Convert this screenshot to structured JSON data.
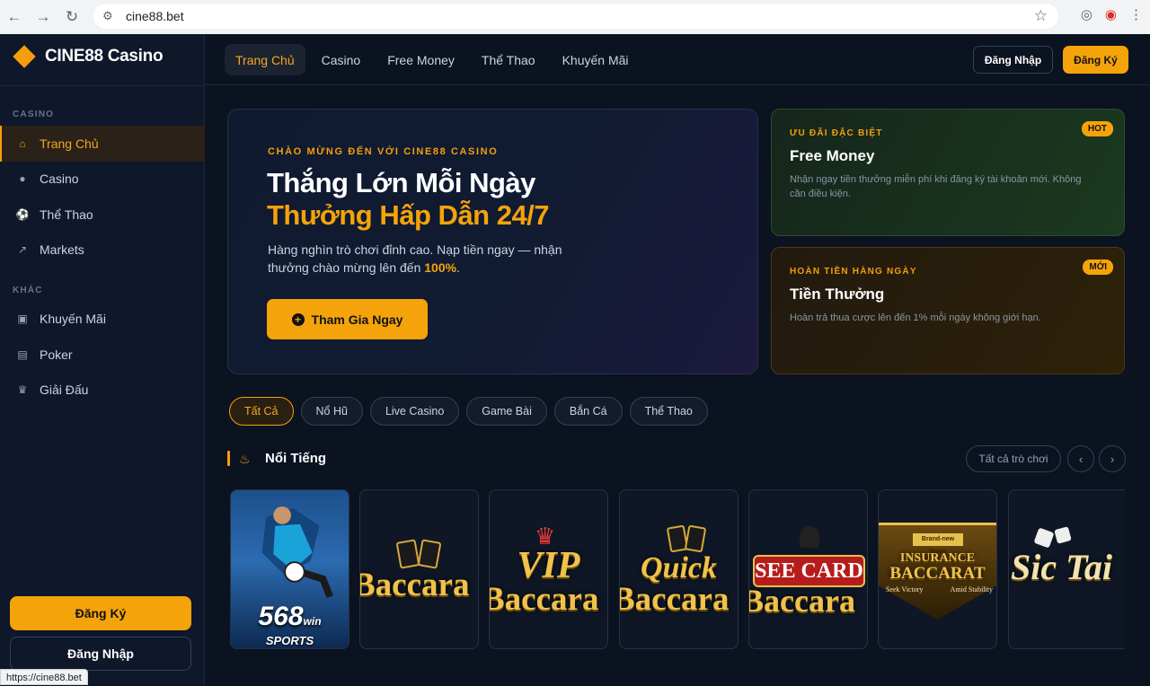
{
  "browser": {
    "url": "cine88.bet",
    "status_url": "https://cine88.bet"
  },
  "brand": {
    "name": "CINE88 Casino",
    "accent": "#f5a30b"
  },
  "sidebar": {
    "section_casino": "CASINO",
    "casino_items": [
      {
        "label": "Trang Chủ",
        "icon": "home-icon",
        "active": true
      },
      {
        "label": "Casino",
        "icon": "chip-icon"
      },
      {
        "label": "Thể Thao",
        "icon": "soccer-ball-icon"
      },
      {
        "label": "Markets",
        "icon": "trend-icon"
      }
    ],
    "section_other": "KHÁC",
    "other_items": [
      {
        "label": "Khuyến Mãi",
        "icon": "gift-icon"
      },
      {
        "label": "Poker",
        "icon": "card-icon"
      },
      {
        "label": "Giải Đấu",
        "icon": "trophy-icon"
      }
    ],
    "register_label": "Đăng Ký",
    "login_label": "Đăng Nhập"
  },
  "topnav": {
    "tabs": [
      {
        "label": "Trang Chủ",
        "active": true
      },
      {
        "label": "Casino"
      },
      {
        "label": "Free Money"
      },
      {
        "label": "Thể Thao"
      },
      {
        "label": "Khuyến Mãi"
      }
    ],
    "login_label": "Đăng Nhập",
    "register_label": "Đăng Ký"
  },
  "hero": {
    "kicker": "CHÀO MỪNG ĐẾN VỚI CINE88 CASINO",
    "title_line1": "Thắng Lớn Mỗi Ngày",
    "title_line2": "Thưởng Hấp Dẫn 24/7",
    "desc_prefix": "Hàng nghìn trò chơi đỉnh cao. Nạp tiền ngay — nhận thưởng chào mừng lên đến ",
    "desc_highlight": "100%",
    "desc_suffix": ".",
    "cta_label": "Tham Gia Ngay"
  },
  "promos": [
    {
      "kicker": "ƯU ĐÃI ĐẶC BIỆT",
      "title": "Free Money",
      "desc": "Nhận ngay tiền thưởng miễn phí khi đăng ký tài khoản mới. Không cần điều kiện.",
      "badge": "HOT"
    },
    {
      "kicker": "HOÀN TIỀN HÀNG NGÀY",
      "title": "Tiền Thưởng",
      "desc": "Hoàn trả thua cược lên đến 1% mỗi ngày không giới hạn.",
      "badge": "MỚI"
    }
  ],
  "filters": [
    {
      "label": "Tất Cả",
      "active": true
    },
    {
      "label": "Nổ Hũ"
    },
    {
      "label": "Live Casino"
    },
    {
      "label": "Game Bài"
    },
    {
      "label": "Bắn Cá"
    },
    {
      "label": "Thể Thao"
    }
  ],
  "section": {
    "title": "Nổi Tiếng",
    "icon": "flame-icon",
    "all_label": "Tất cả trò chơi"
  },
  "games": [
    {
      "name": "568win Sports",
      "line1": "568",
      "line1_suffix": "win",
      "line2": "SPORTS"
    },
    {
      "name": "Baccarat",
      "line1": "Baccara"
    },
    {
      "name": "VIP Baccarat",
      "line1": "VIP",
      "line2": "Baccara"
    },
    {
      "name": "Quick Baccarat",
      "line1": "Quick",
      "line2": "Baccara"
    },
    {
      "name": "See Card Baccarat",
      "line1": "SEE CARD",
      "line2": "Baccara"
    },
    {
      "name": "Insurance Baccarat",
      "line0": "Brand-new Game",
      "line1": "INSURANCE",
      "line2": "BACCARAT",
      "line3": "Seek Victory",
      "line4": "Amid Stability"
    },
    {
      "name": "Sic Tai",
      "line1": "Sic Tai"
    }
  ]
}
